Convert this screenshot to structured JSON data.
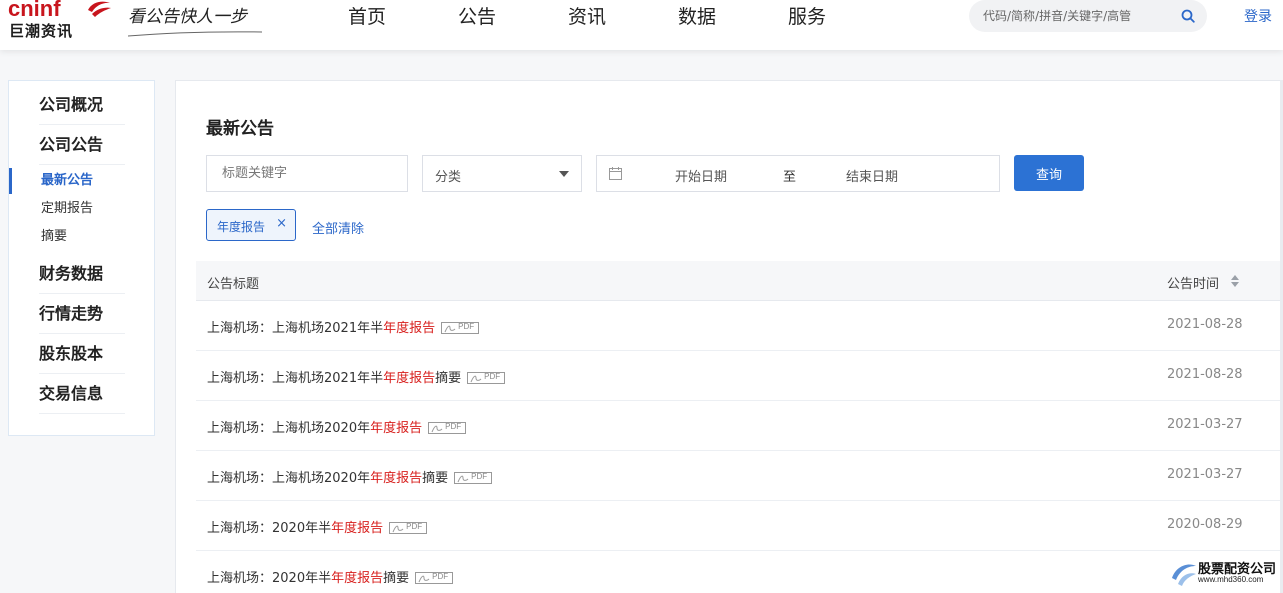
{
  "brand": {
    "logo_top": "cninf",
    "logo_bottom": "巨潮资讯",
    "slogan": "看公告快人一步",
    "red": "#c8151d"
  },
  "nav": {
    "items": [
      {
        "label": "首页"
      },
      {
        "label": "公告"
      },
      {
        "label": "资讯"
      },
      {
        "label": "数据"
      },
      {
        "label": "服务"
      }
    ]
  },
  "search": {
    "placeholder": "代码/简称/拼音/关键字/高管",
    "icon": "search-icon"
  },
  "header": {
    "login_label": "登录"
  },
  "sidebar": {
    "groups": [
      {
        "label": "公司概况"
      },
      {
        "label": "公司公告"
      },
      {
        "label": "财务数据"
      },
      {
        "label": "行情走势"
      },
      {
        "label": "股东股本"
      },
      {
        "label": "交易信息"
      }
    ],
    "subitems": [
      {
        "label": "最新公告",
        "active": true
      },
      {
        "label": "定期报告"
      },
      {
        "label": "摘要"
      }
    ]
  },
  "main": {
    "title": "最新公告",
    "filters": {
      "keyword_placeholder": "标题关键字",
      "category_label": "分类",
      "date_start": "开始日期",
      "date_sep": "至",
      "date_end": "结束日期",
      "query_label": "查询"
    },
    "active_tag": "年度报告",
    "tag_close": "×",
    "clear_all": "全部清除",
    "table": {
      "col_title": "公告标题",
      "col_time": "公告时间",
      "pdf_label": "PDF",
      "rows": [
        {
          "prefix": "上海机场：上海机场2021年半",
          "highlight": "年度报告",
          "suffix": "",
          "date": "2021-08-28"
        },
        {
          "prefix": "上海机场：上海机场2021年半",
          "highlight": "年度报告",
          "suffix": "摘要",
          "date": "2021-08-28"
        },
        {
          "prefix": "上海机场：上海机场2020年",
          "highlight": "年度报告",
          "suffix": "",
          "date": "2021-03-27"
        },
        {
          "prefix": "上海机场：上海机场2020年",
          "highlight": "年度报告",
          "suffix": "摘要",
          "date": "2021-03-27"
        },
        {
          "prefix": "上海机场：2020年半",
          "highlight": "年度报告",
          "suffix": "",
          "date": "2020-08-29"
        },
        {
          "prefix": "上海机场：2020年半",
          "highlight": "年度报告",
          "suffix": "摘要",
          "date": ""
        }
      ]
    }
  },
  "watermark": {
    "title": "股票配资公司",
    "url": "www.mhd360.com"
  },
  "colors": {
    "accent": "#2b67c9",
    "button": "#2c72d4",
    "highlight": "#d8201e"
  }
}
